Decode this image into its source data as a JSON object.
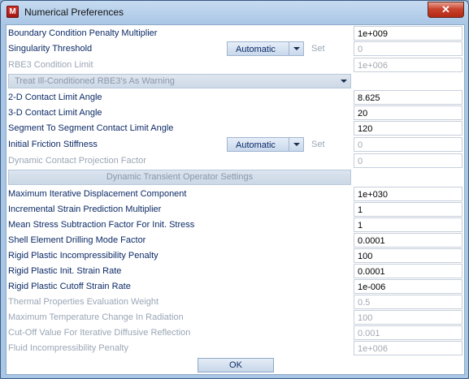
{
  "window": {
    "title": "Numerical Preferences",
    "app_icon_letter": "M",
    "close_glyph": "✕"
  },
  "rows": {
    "r0": {
      "label": "Boundary Condition Penalty Multiplier",
      "value": "1e+009"
    },
    "r1": {
      "label": "Singularity Threshold",
      "combo": "Automatic",
      "set": "Set",
      "value": "0"
    },
    "r2": {
      "label": "RBE3 Condition Limit",
      "value": "1e+006"
    },
    "r3": {
      "label": "Treat Ill-Conditioned RBE3's As Warning"
    },
    "r4": {
      "label": "2-D Contact Limit Angle",
      "value": "8.625"
    },
    "r5": {
      "label": "3-D Contact Limit Angle",
      "value": "20"
    },
    "r6": {
      "label": "Segment To Segment Contact Limit Angle",
      "value": "120"
    },
    "r7": {
      "label": "Initial Friction Stiffness",
      "combo": "Automatic",
      "set": "Set",
      "value": "0"
    },
    "r8": {
      "label": "Dynamic Contact Projection Factor",
      "value": "0"
    },
    "r9": {
      "label": "Dynamic Transient Operator Settings"
    },
    "r10": {
      "label": "Maximum Iterative Displacement Component",
      "value": "1e+030"
    },
    "r11": {
      "label": "Incremental Strain Prediction Multiplier",
      "value": "1"
    },
    "r12": {
      "label": "Mean Stress Subtraction Factor For Init. Stress",
      "value": "1"
    },
    "r13": {
      "label": "Shell Element Drilling Mode Factor",
      "value": "0.0001"
    },
    "r14": {
      "label": "Rigid Plastic Incompressibility Penalty",
      "value": "100"
    },
    "r15": {
      "label": "Rigid Plastic Init. Strain Rate",
      "value": "0.0001"
    },
    "r16": {
      "label": "Rigid Plastic Cutoff Strain Rate",
      "value": "1e-006"
    },
    "r17": {
      "label": "Thermal Properties Evaluation Weight",
      "value": "0.5"
    },
    "r18": {
      "label": "Maximum Temperature Change In Radiation",
      "value": "100"
    },
    "r19": {
      "label": "Cut-Off Value For Iterative Diffusive Reflection",
      "value": "0.001"
    },
    "r20": {
      "label": "Fluid Incompressibility Penalty",
      "value": "1e+006"
    }
  },
  "footer": {
    "ok_label": "OK"
  }
}
